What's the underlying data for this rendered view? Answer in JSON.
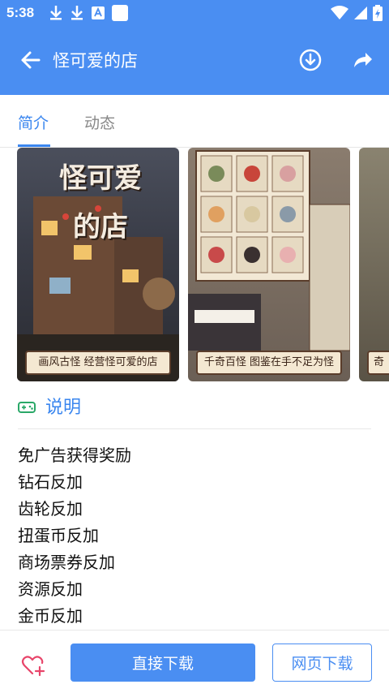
{
  "status_bar": {
    "time": "5:38",
    "left_icons": [
      "download-icon",
      "download-icon",
      "text-box-icon",
      "square-icon"
    ],
    "right_icons": [
      "wifi-icon",
      "signal-icon",
      "battery-charging-icon"
    ]
  },
  "app_bar": {
    "title": "怪可爱的店",
    "back_icon": "arrow-left-icon",
    "download_icon": "download-circle-icon",
    "share_icon": "share-arrow-icon"
  },
  "tabs": [
    {
      "label": "简介",
      "active": true
    },
    {
      "label": "动态",
      "active": false
    }
  ],
  "gallery": {
    "screenshots": [
      {
        "caption": "画风古怪 经营怪可爱的店",
        "logo_text": "怪可爱的店"
      },
      {
        "caption": "千奇百怪 图鉴在手不足为怪"
      },
      {
        "caption": "奇"
      }
    ]
  },
  "section": {
    "title": "说明",
    "icon": "gamepad-icon"
  },
  "description_lines": [
    "免广告获得奖励",
    "钻石反加",
    "齿轮反加",
    "扭蛋币反加",
    "商场票券反加",
    "资源反加",
    "金币反加"
  ],
  "bottom_bar": {
    "favorite_icon": "heart-plus-icon",
    "direct_download_label": "直接下载",
    "web_download_label": "网页下载"
  },
  "colors": {
    "primary": "#4a8ef2",
    "accent_text": "#3a86ef"
  }
}
